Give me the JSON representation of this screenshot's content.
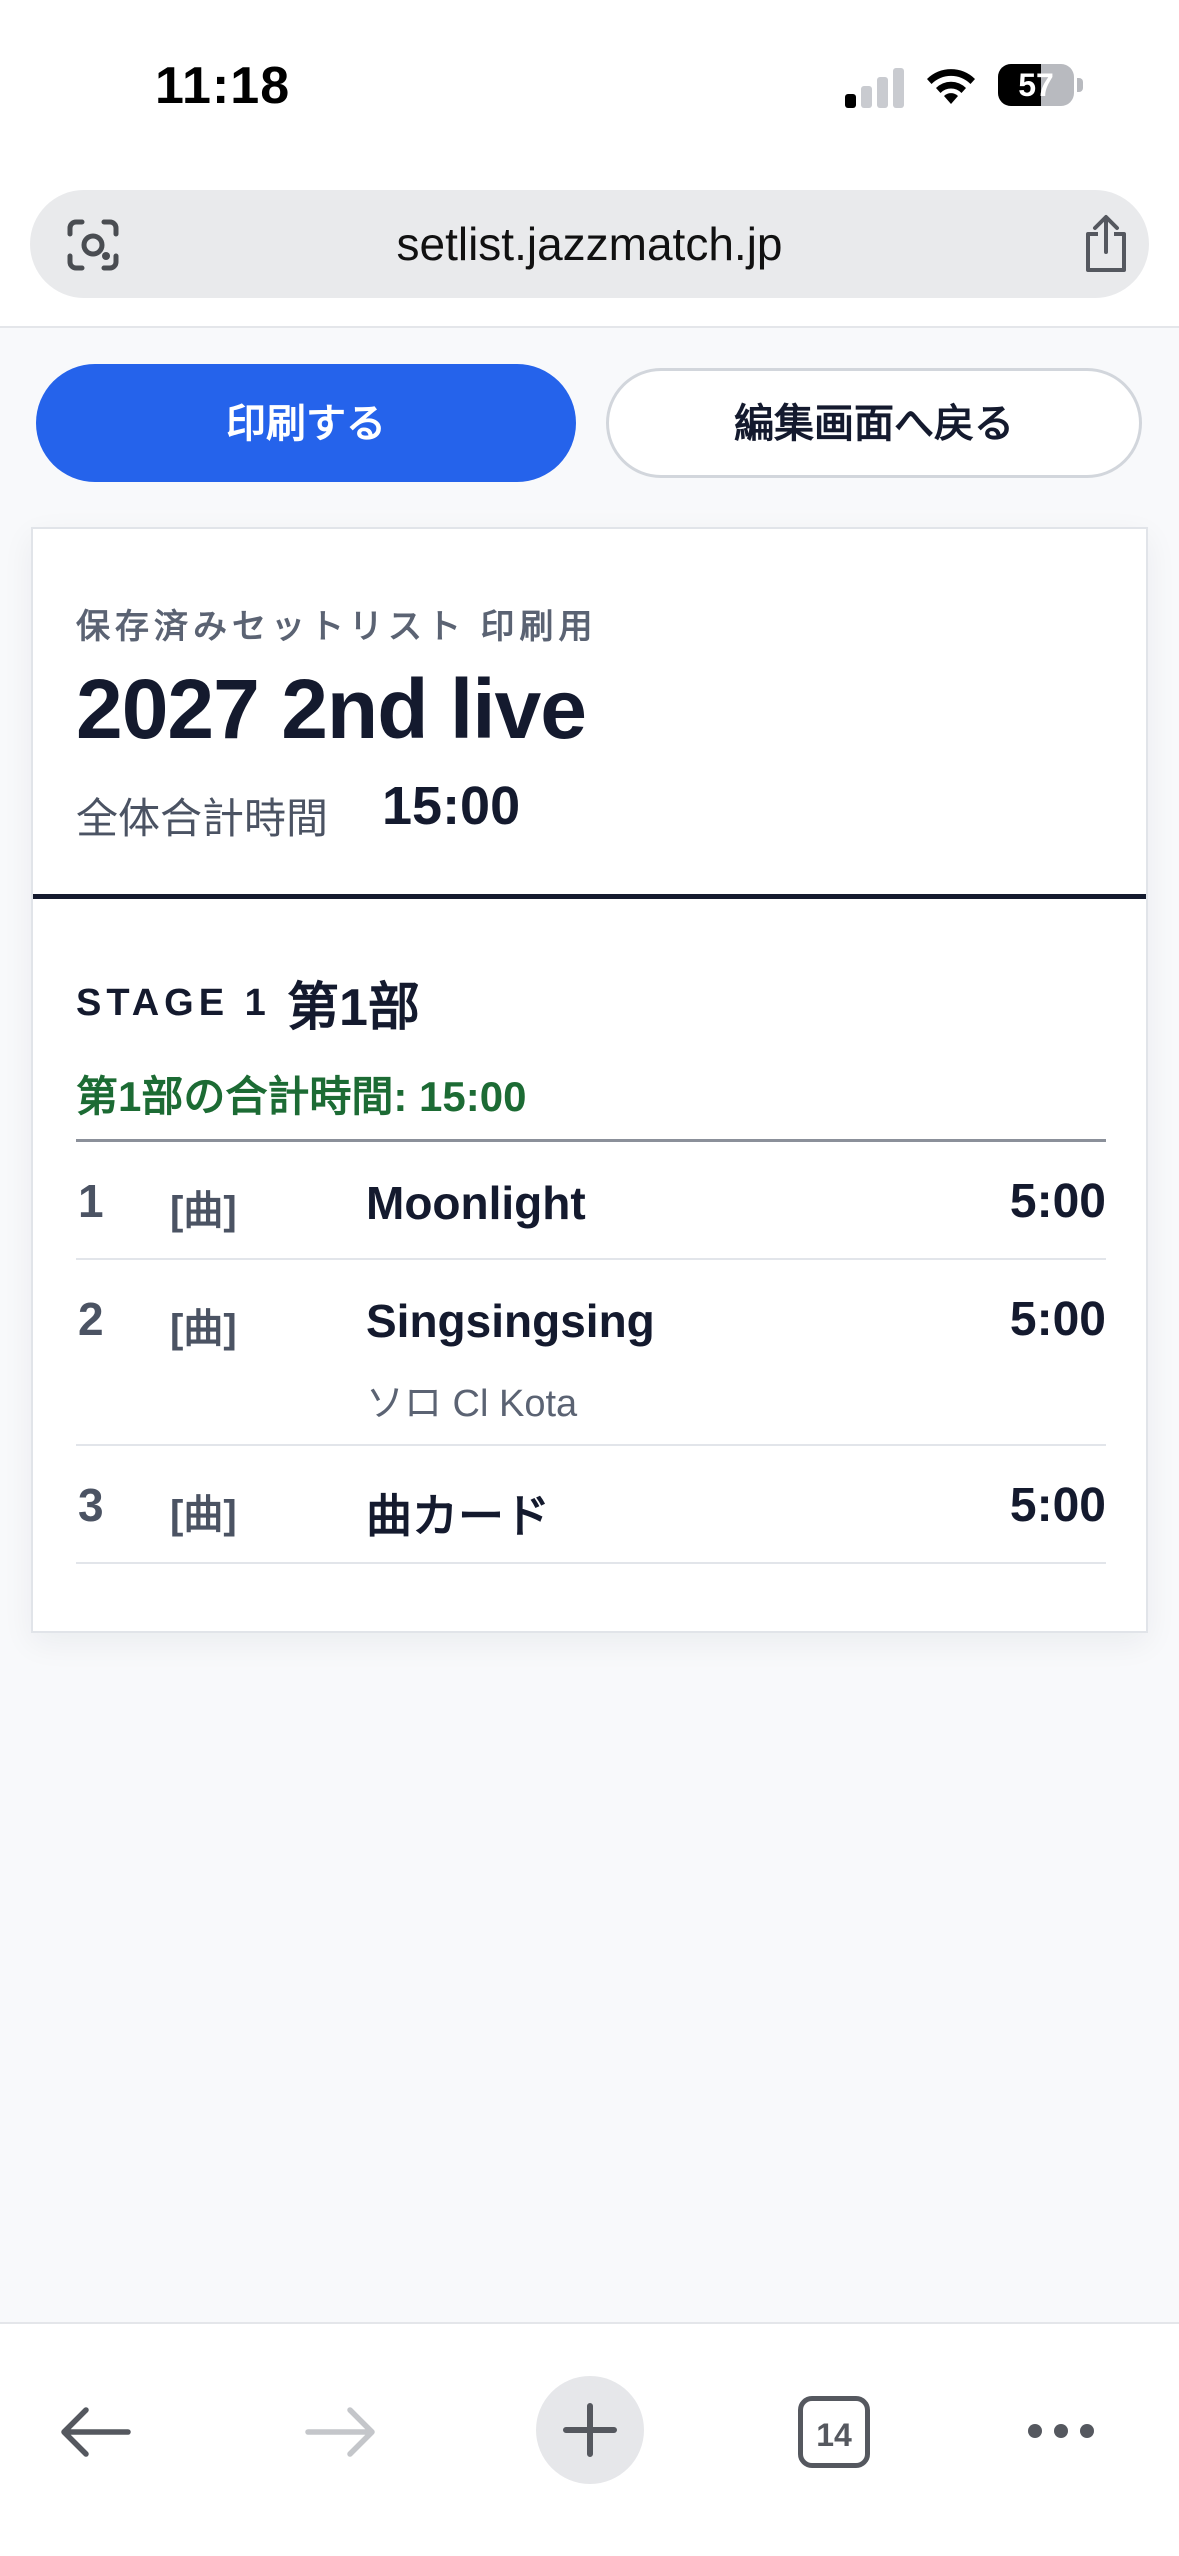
{
  "status_bar": {
    "time": "11:18",
    "battery": "57",
    "battery_level": 0.57,
    "signal_bars_active": 1,
    "signal_bars_total": 4
  },
  "browser": {
    "url": "setlist.jazzmatch.jp",
    "tab_count": "14",
    "icons": {
      "lens": "camera-lens-icon",
      "share": "share-icon",
      "back": "arrow-left-icon",
      "forward": "arrow-right-icon",
      "new_tab": "plus-icon",
      "tabs": "tabs-icon",
      "more": "more-icon"
    }
  },
  "actions": {
    "print_label": "印刷する",
    "back_to_edit_label": "編集画面へ戻る"
  },
  "colors": {
    "primary": "#2563eb",
    "stage_total": "#1c6b34",
    "text_dark": "#141a2e"
  },
  "sheet": {
    "label": "保存済みセットリスト 印刷用",
    "title": "2027 2nd live",
    "total_label": "全体合計時間",
    "total_time": "15:00",
    "stage": {
      "label": "STAGE 1",
      "name": "第1部",
      "total": "第1部の合計時間: 15:00",
      "songs": [
        {
          "no": "1",
          "type": "[曲]",
          "title": "Moonlight",
          "note": "",
          "time": "5:00"
        },
        {
          "no": "2",
          "type": "[曲]",
          "title": "Singsingsing",
          "note": "ソロ Cl Kota",
          "time": "5:00"
        },
        {
          "no": "3",
          "type": "[曲]",
          "title": "曲カード",
          "note": "",
          "time": "5:00"
        }
      ]
    }
  }
}
